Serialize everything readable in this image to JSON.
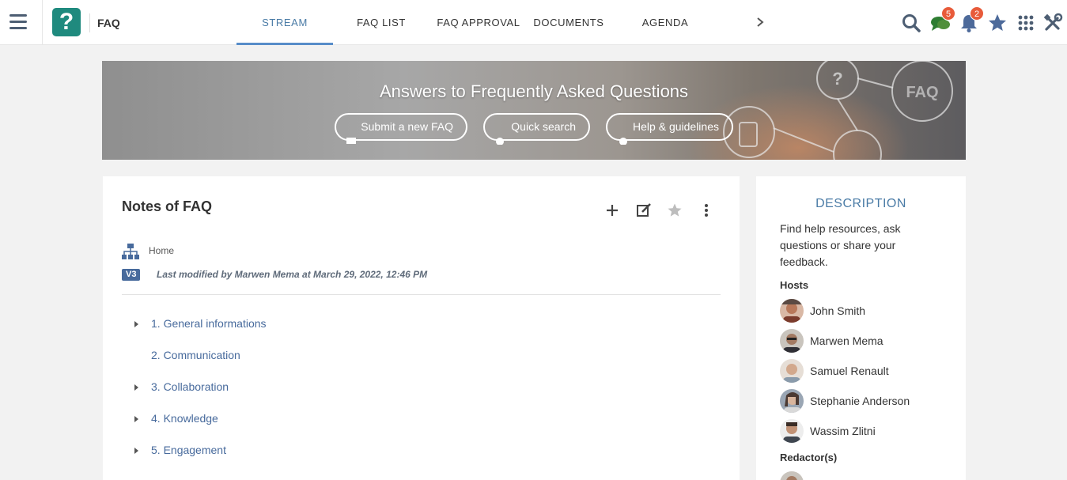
{
  "topbar": {
    "space_name": "FAQ",
    "logo_glyph": "?",
    "tabs": [
      {
        "label": "STREAM",
        "active": true
      },
      {
        "label": "FAQ LIST",
        "active": false
      },
      {
        "label": "FAQ APPROVAL",
        "active": false
      },
      {
        "label": "DOCUMENTS",
        "active": false
      },
      {
        "label": "AGENDA",
        "active": false
      }
    ],
    "icons": {
      "menu": "hamburger-icon",
      "next": "chevron-right-icon",
      "search": "search-icon",
      "chat": "chat-bubbles-icon",
      "notifications": "bell-icon",
      "favorites": "star-icon",
      "apps": "grid-icon",
      "admin": "tools-icon"
    },
    "chat_badge": "5",
    "notifications_badge": "2"
  },
  "banner": {
    "title": "Answers to Frequently Asked Questions",
    "buttons": [
      {
        "label": "Submit a new FAQ"
      },
      {
        "label": "Quick search"
      },
      {
        "label": "Help & guidelines"
      }
    ]
  },
  "notes": {
    "title": "Notes of FAQ",
    "breadcrumb": "Home",
    "version": "V3",
    "last_modified": "Last modified by Marwen Mema at March 29, 2022, 12:46 PM",
    "items": [
      {
        "label": "1. General informations",
        "expandable": true
      },
      {
        "label": "2. Communication",
        "expandable": false
      },
      {
        "label": "3. Collaboration",
        "expandable": true
      },
      {
        "label": "4. Knowledge",
        "expandable": true
      },
      {
        "label": "5. Engagement",
        "expandable": true
      }
    ]
  },
  "description": {
    "title": "DESCRIPTION",
    "text": "Find help resources, ask questions or share your feedback.",
    "hosts_label": "Hosts",
    "hosts": [
      {
        "name": "John Smith"
      },
      {
        "name": "Marwen Mema"
      },
      {
        "name": "Samuel Renault"
      },
      {
        "name": "Stephanie Anderson"
      },
      {
        "name": "Wassim Zlitni"
      }
    ],
    "redactors_label": "Redactor(s)"
  },
  "colors": {
    "accent": "#578dc9",
    "link": "#476a9c",
    "logo": "#1f8a7e",
    "badge": "#e85b3a"
  }
}
